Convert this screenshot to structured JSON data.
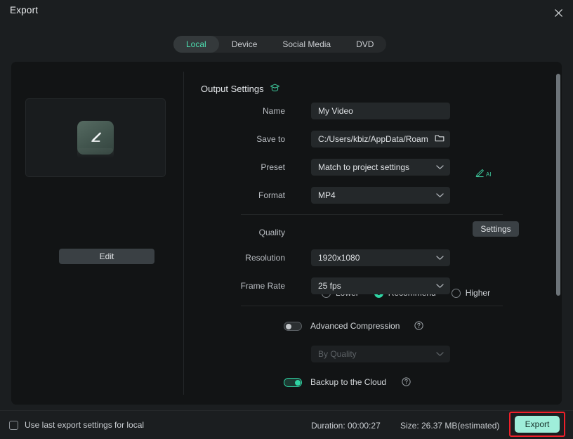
{
  "window": {
    "title": "Export",
    "close_icon": "close-icon"
  },
  "tabs": [
    {
      "label": "Local",
      "active": true
    },
    {
      "label": "Device",
      "active": false
    },
    {
      "label": "Social Media",
      "active": false
    },
    {
      "label": "DVD",
      "active": false
    }
  ],
  "preview": {
    "thumb_icon": "edit-pencil-icon",
    "edit_label": "Edit"
  },
  "output": {
    "section_title": "Output Settings",
    "section_icon": "graduation-cap-icon",
    "name_label": "Name",
    "name_value": "My Video",
    "ai_icon": "ai-pen-icon",
    "ai_badge": "AI",
    "saveto_label": "Save to",
    "saveto_value": "C:/Users/kbiz/AppData/Roam",
    "folder_icon": "folder-icon",
    "preset_label": "Preset",
    "preset_value": "Match to project settings",
    "settings_button": "Settings",
    "format_label": "Format",
    "format_value": "MP4"
  },
  "quality": {
    "label": "Quality",
    "options": [
      {
        "label": "Lower",
        "selected": false
      },
      {
        "label": "Recommend",
        "selected": true
      },
      {
        "label": "Higher",
        "selected": false
      }
    ],
    "resolution_label": "Resolution",
    "resolution_value": "1920x1080",
    "framerate_label": "Frame Rate",
    "framerate_value": "25 fps"
  },
  "advanced": {
    "compression_label": "Advanced Compression",
    "compression_on": false,
    "compression_help_icon": "help-circle-icon",
    "compression_mode_placeholder": "By Quality",
    "backup_label": "Backup to the Cloud",
    "backup_on": true,
    "backup_help_icon": "help-circle-icon"
  },
  "footer": {
    "use_last_settings_label": "Use last export settings for local",
    "use_last_settings_checked": false,
    "duration": "Duration: 00:00:27",
    "size": "Size: 26.37 MB(estimated)",
    "export_label": "Export"
  },
  "colors": {
    "accent": "#2fd5a4",
    "export_button": "#9feeda",
    "highlight_border": "#f0202a",
    "panel_bg": "#121415",
    "window_bg": "#1b1e20",
    "field_bg": "#24282a"
  }
}
